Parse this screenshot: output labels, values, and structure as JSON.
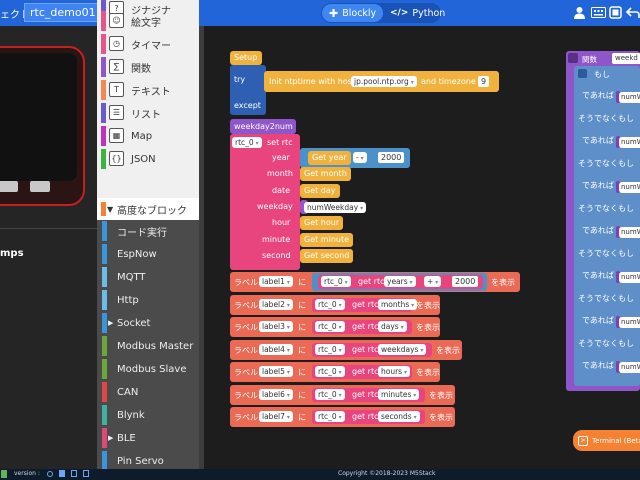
{
  "header": {
    "project_label_fragment": "ェクト",
    "project_name": "rtc_demo01",
    "mode_blockly": "Blockly",
    "mode_python": "Python",
    "mode_python_icon": "</>"
  },
  "device": {
    "label_fragment": "mps"
  },
  "toolbox": {
    "items": [
      {
        "label": "ジナジナ",
        "icon": "?",
        "color": "#6a5acd"
      },
      {
        "label": "絵文字",
        "icon": "☺",
        "color": "#e5578b"
      },
      {
        "label": "タイマー",
        "icon": "◷",
        "color": "#e5578b"
      },
      {
        "label": "関数",
        "icon": "∑",
        "color": "#8e56c8"
      },
      {
        "label": "テキスト",
        "icon": "T",
        "color": "#ef8a50"
      },
      {
        "label": "リスト",
        "icon": "☰",
        "color": "#6a5acd"
      },
      {
        "label": "Map",
        "icon": "▦",
        "color": "#c330c0"
      },
      {
        "label": "JSON",
        "icon": "{}",
        "color": "#3eb33e"
      }
    ],
    "advanced_label": "高度なブロック",
    "advanced_items": [
      {
        "label": "コード実行",
        "color": "#3a96dc",
        "arrow": ""
      },
      {
        "label": "EspNow",
        "color": "#3a96dc",
        "arrow": ""
      },
      {
        "label": "MQTT",
        "color": "#6bbde8",
        "arrow": ""
      },
      {
        "label": "Http",
        "color": "#6bbde8",
        "arrow": ""
      },
      {
        "label": "Socket",
        "color": "#3a96dc",
        "arrow": "▶"
      },
      {
        "label": "Modbus Master",
        "color": "#6aa83e",
        "arrow": ""
      },
      {
        "label": "Modbus Slave",
        "color": "#6aa83e",
        "arrow": ""
      },
      {
        "label": "CAN",
        "color": "#e04848",
        "arrow": ""
      },
      {
        "label": "Blynk",
        "color": "#40b0a0",
        "arrow": ""
      },
      {
        "label": "BLE",
        "color": "#e04878",
        "arrow": "▶"
      },
      {
        "label": "Pin Servo",
        "color": "#3a96dc",
        "arrow": ""
      }
    ]
  },
  "blocks": {
    "setup": "Setup",
    "try": "try",
    "except": "except",
    "ntp_text": "Init ntptime with host",
    "ntp_host": "jp.pool.ntp.org",
    "ntp_tz_label": "and timezone",
    "ntp_tz": "9",
    "func_name": "weekday2num",
    "rtc_var": "rtc_0",
    "set_rtc": "set rtc",
    "fields": [
      {
        "label": "year",
        "value": "Get year",
        "op": "-",
        "num": "2000"
      },
      {
        "label": "month",
        "value": "Get month"
      },
      {
        "label": "date",
        "value": "Get day"
      },
      {
        "label": "weekday",
        "value": "numWeekday"
      },
      {
        "label": "hour",
        "value": "Get hour"
      },
      {
        "label": "minute",
        "value": "Get minute"
      },
      {
        "label": "second",
        "value": "Get second"
      }
    ],
    "label_rows": [
      {
        "label_kw": "ラベル",
        "label": "label1",
        "ni": "に",
        "rtc": "rtc_0",
        "get": "get rtc",
        "field": "years",
        "op": "+",
        "num": "2000",
        "show": "を表示"
      },
      {
        "label_kw": "ラベル",
        "label": "label2",
        "ni": "に",
        "rtc": "rtc_0",
        "get": "get rtc",
        "field": "months",
        "show": "を表示"
      },
      {
        "label_kw": "ラベル",
        "label": "label3",
        "ni": "に",
        "rtc": "rtc_0",
        "get": "get rtc",
        "field": "days",
        "show": "を表示"
      },
      {
        "label_kw": "ラベル",
        "label": "label4",
        "ni": "に",
        "rtc": "rtc_0",
        "get": "get rtc",
        "field": "weekdays",
        "show": "を表示"
      },
      {
        "label_kw": "ラベル",
        "label": "label5",
        "ni": "に",
        "rtc": "rtc_0",
        "get": "get rtc",
        "field": "hours",
        "show": "を表示"
      },
      {
        "label_kw": "ラベル",
        "label": "label6",
        "ni": "に",
        "rtc": "rtc_0",
        "get": "get rtc",
        "field": "minutes",
        "show": "を表示"
      },
      {
        "label_kw": "ラベル",
        "label": "label7",
        "ni": "に",
        "rtc": "rtc_0",
        "get": "get rtc",
        "field": "seconds",
        "show": "を表示"
      }
    ],
    "right_func": "関数",
    "right_func_name": "weekd",
    "right_if": "もし",
    "right_rows": [
      {
        "kw": "であれば",
        "var": "numW"
      },
      {
        "kw": "そうでなくもし",
        "var": ""
      },
      {
        "kw": "であれば",
        "var": "numW"
      },
      {
        "kw": "そうでなくもし",
        "var": ""
      },
      {
        "kw": "であれば",
        "var": "numW"
      },
      {
        "kw": "そうでなくもし",
        "var": ""
      },
      {
        "kw": "であれば",
        "var": "numW"
      },
      {
        "kw": "そうでなくもし",
        "var": ""
      },
      {
        "kw": "であれば",
        "var": "numW"
      },
      {
        "kw": "そうでなくもし",
        "var": ""
      },
      {
        "kw": "であれば",
        "var": "numW"
      },
      {
        "kw": "そうでなくもし",
        "var": ""
      },
      {
        "kw": "であれば",
        "var": "numW"
      }
    ]
  },
  "terminal": {
    "label": "Terminal (Beta"
  },
  "footer": {
    "version_label": "version :",
    "copyright": "Copyright ©2018-2023 M5Stack"
  },
  "colors": {
    "topbar": "#2165d9",
    "workspace": "#1d1d1d",
    "setup": "#f0b23c",
    "func": "#e84e87",
    "label_row": "#ea6a55",
    "rtc": "#e8457f",
    "math": "#4a92c9",
    "var": "#9b56c6",
    "try": "#2f5fb2"
  }
}
